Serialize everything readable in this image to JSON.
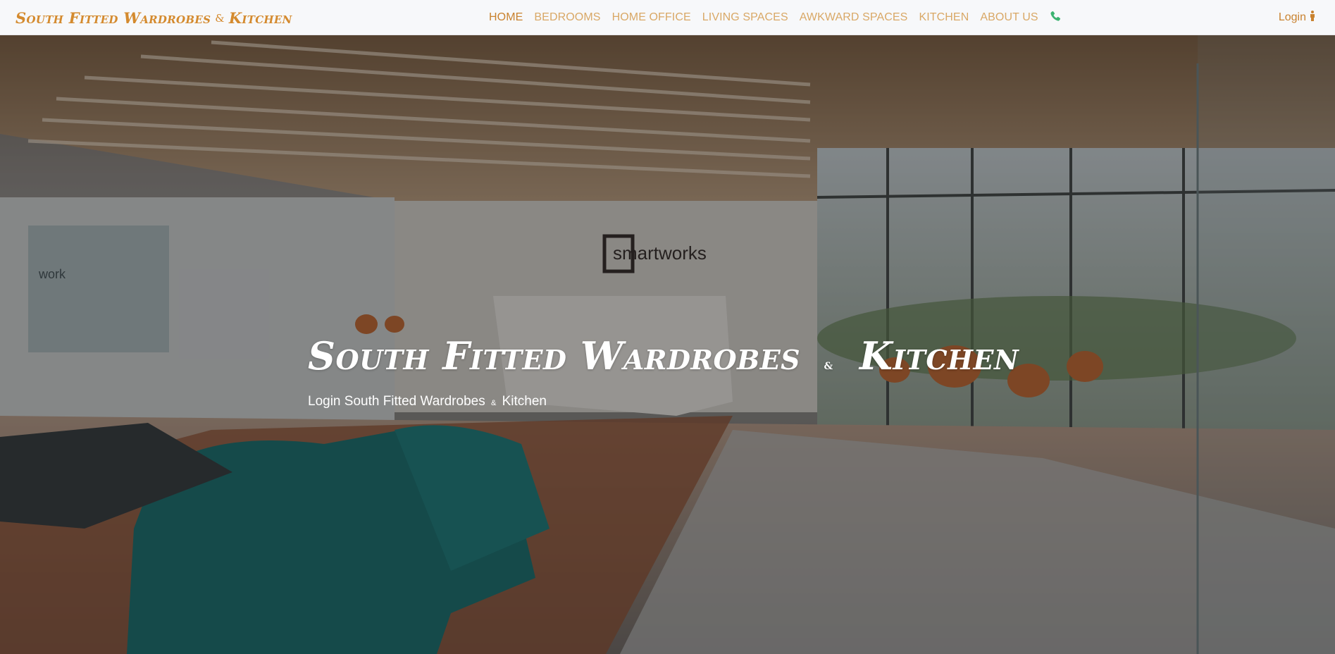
{
  "brand": {
    "part1": "South Fitted Wardrobes",
    "amp": "&",
    "part2": "Kitchen"
  },
  "nav": {
    "items": [
      {
        "label": "HOME",
        "active": true
      },
      {
        "label": "BEDROOMS"
      },
      {
        "label": "HOME OFFICE"
      },
      {
        "label": "LIVING SPACES"
      },
      {
        "label": "AWKWARD SPACES"
      },
      {
        "label": "KITCHEN"
      },
      {
        "label": "ABOUT US"
      }
    ],
    "phone_icon": "phone-icon",
    "login_label": "Login",
    "login_icon": "person-icon"
  },
  "hero": {
    "title_part1": "South Fitted Wardrobes",
    "title_amp": "&",
    "title_part2": "Kitchen",
    "subtitle_part1": "Login South Fitted Wardrobes",
    "subtitle_amp": "&",
    "subtitle_part2": "Kitchen",
    "photo_sign": "smartworks",
    "photo_wall_text": "work"
  },
  "colors": {
    "brand": "#d48a2e",
    "nav_link": "#d9a866",
    "phone": "#3cb371",
    "navbar_bg": "#f7f8fa"
  }
}
